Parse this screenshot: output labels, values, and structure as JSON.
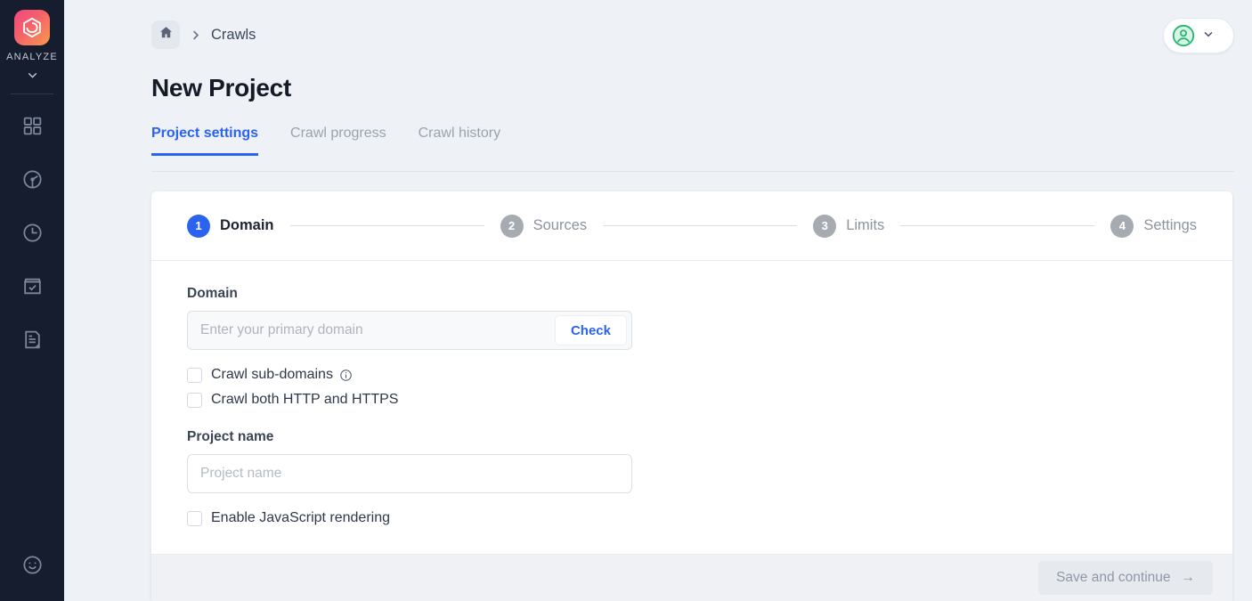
{
  "sidebar": {
    "logo_icon": "hexagon-loop-logo-icon",
    "brand": "ANALYZE",
    "expand_icon": "chevron-down-icon",
    "items": [
      {
        "icon": "grid-dashboard-icon"
      },
      {
        "icon": "pie-chart-icon"
      },
      {
        "icon": "clock-icon"
      },
      {
        "icon": "checkbox-box-icon"
      },
      {
        "icon": "document-icon"
      }
    ],
    "bottom_item": {
      "icon": "smiley-face-icon"
    }
  },
  "topbar": {
    "home_icon": "home-icon",
    "separator_icon": "chevron-right-icon",
    "breadcrumb": "Crawls",
    "user": {
      "avatar_icon": "user-avatar-icon",
      "caret_icon": "chevron-down-icon"
    }
  },
  "page": {
    "title": "New Project",
    "tabs": [
      {
        "label": "Project settings",
        "active": true
      },
      {
        "label": "Crawl progress",
        "active": false
      },
      {
        "label": "Crawl history",
        "active": false
      }
    ]
  },
  "stepper": {
    "steps": [
      {
        "num": "1",
        "label": "Domain",
        "active": true
      },
      {
        "num": "2",
        "label": "Sources",
        "active": false
      },
      {
        "num": "3",
        "label": "Limits",
        "active": false
      },
      {
        "num": "4",
        "label": "Settings",
        "active": false
      }
    ]
  },
  "form": {
    "domain_label": "Domain",
    "domain_placeholder": "Enter your primary domain",
    "domain_value": "",
    "check_button": "Check",
    "checkbox_subdomains": {
      "label": "Crawl sub-domains",
      "checked": false,
      "info_icon": "info-circle-icon"
    },
    "checkbox_http_https": {
      "label": "Crawl both HTTP and HTTPS",
      "checked": false
    },
    "project_name_label": "Project name",
    "project_name_placeholder": "Project name",
    "project_name_value": "",
    "checkbox_js_rendering": {
      "label": "Enable JavaScript rendering",
      "checked": false
    }
  },
  "footer": {
    "save_label": "Save and continue",
    "arrow_icon": "arrow-right-icon"
  },
  "colors": {
    "accent_blue": "#2b63f0",
    "page_bg": "#eef1f6",
    "sidebar_bg": "#161d2e",
    "avatar_green": "#22b573"
  }
}
